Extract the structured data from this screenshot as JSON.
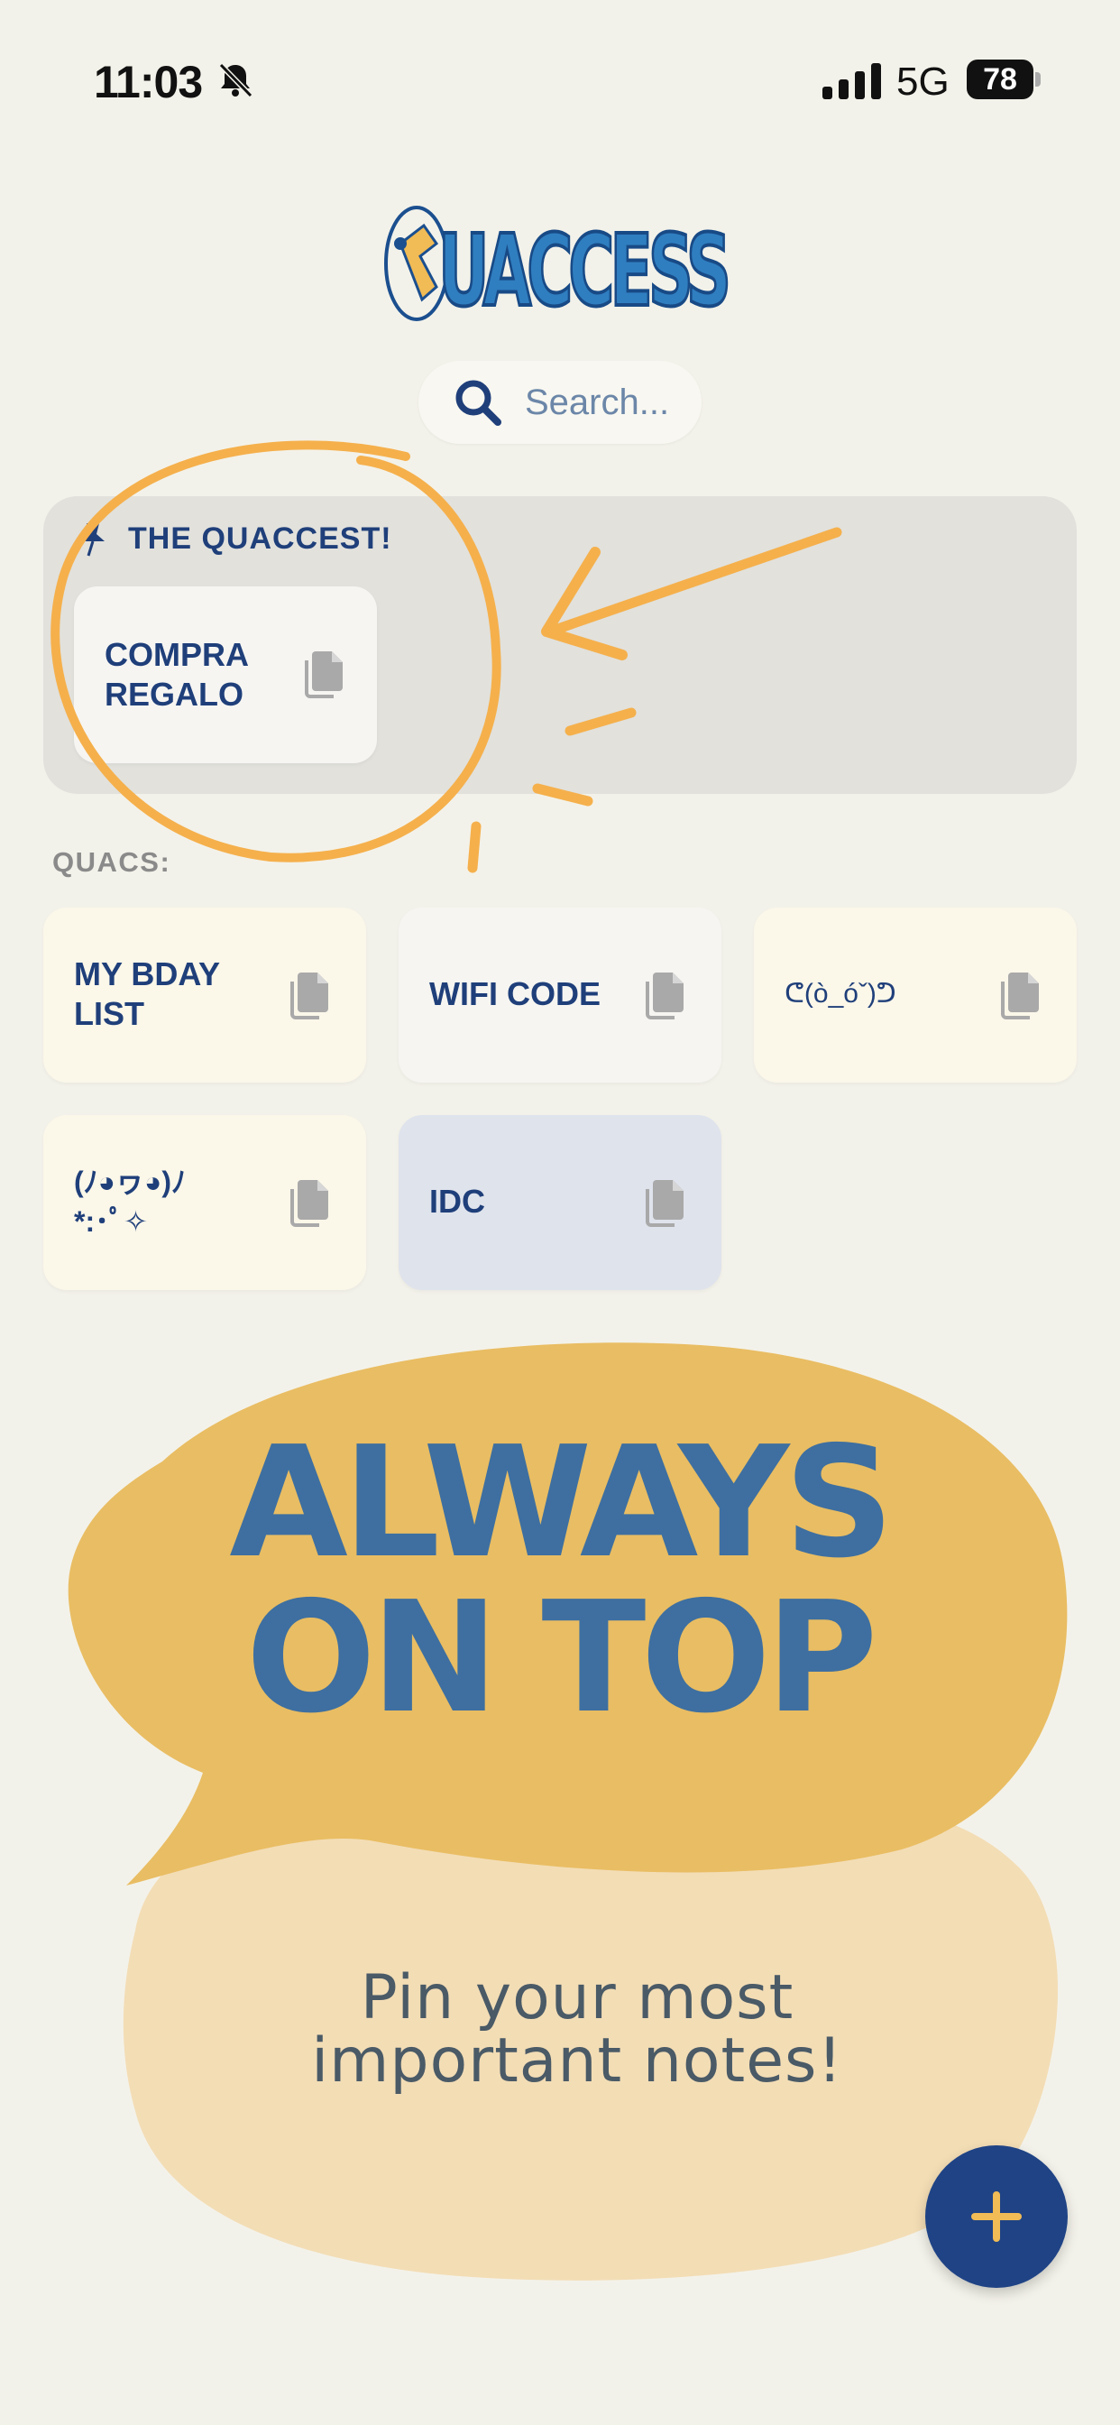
{
  "status_bar": {
    "time": "11:03",
    "network": "5G",
    "battery": "78",
    "icons": [
      "bell-slash-icon",
      "signal-icon",
      "battery-icon"
    ]
  },
  "app": {
    "logo_text": "QUACCESS"
  },
  "search": {
    "placeholder": "Search..."
  },
  "pinned": {
    "title": "THE QUACCEST!",
    "items": [
      {
        "label": "COMPRA\nREGALO"
      }
    ]
  },
  "quacs": {
    "title": "QUACS:",
    "items": [
      {
        "label": "MY BDAY\nLIST",
        "color": "#fbf7e9"
      },
      {
        "label": "WIFI CODE",
        "color": "#f6f5f1"
      },
      {
        "label": "ᕦ(ò_óˇ)ᕤ",
        "color": "#fbf7e9"
      },
      {
        "label": "(ﾉ◕ヮ◕)ﾉ\n*:･ﾟ✧",
        "color": "#fbf7e9"
      },
      {
        "label": "IDC",
        "color": "#dfe3ec"
      }
    ]
  },
  "promo": {
    "headline_line1": "ALWAYS",
    "headline_line2": "ON TOP",
    "subline_line1": "Pin your most",
    "subline_line2": "important notes!"
  },
  "colors": {
    "background": "#f3f2ea",
    "navy": "#1f3f7a",
    "accent_orange": "#f5b04c",
    "bubble_yellow": "#e9bd63",
    "bubble_light": "#f3ddb5",
    "headline_blue": "#3e6fa0"
  }
}
